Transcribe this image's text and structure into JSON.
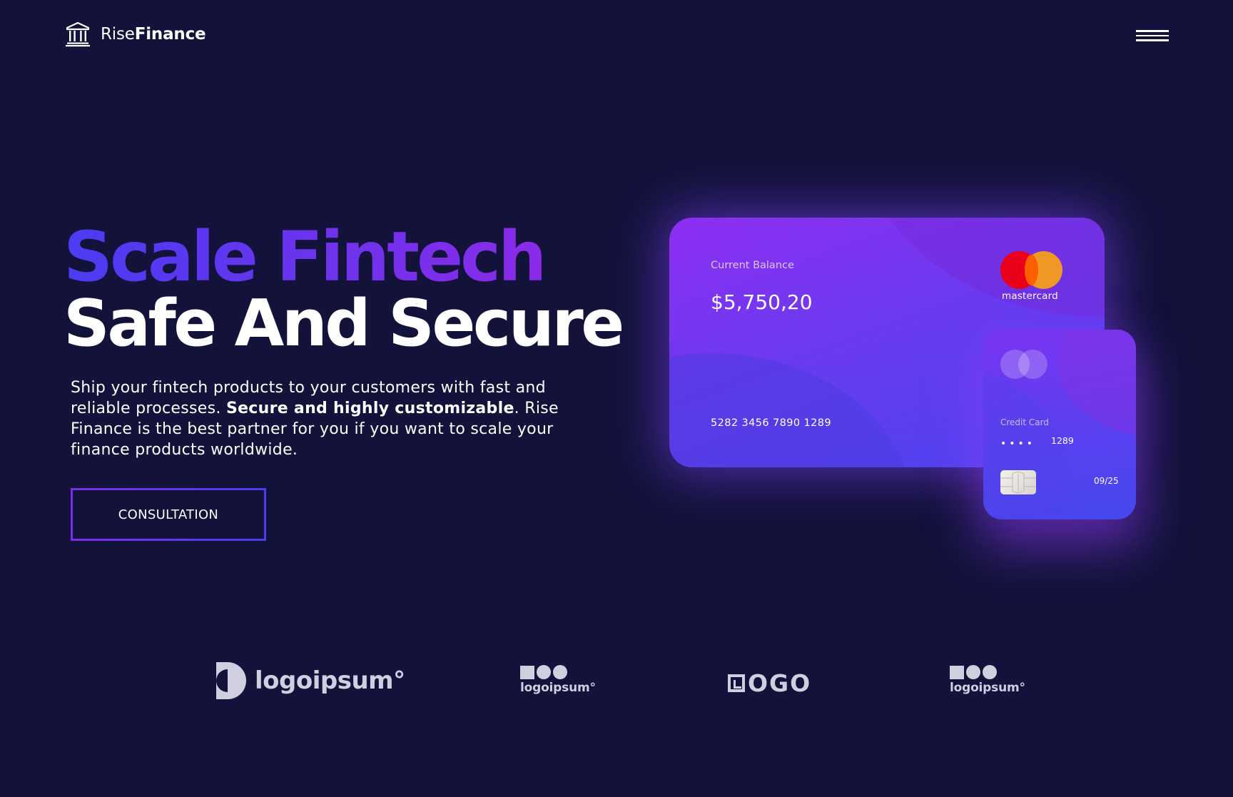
{
  "header": {
    "brand_light": "Rise",
    "brand_bold": "Finance",
    "brand_icon": "bank-icon",
    "menu_icon": "hamburger-menu-icon"
  },
  "hero": {
    "headline_line1": "Scale Fintech",
    "headline_line2": "Safe And Secure",
    "lede_part1": "Ship your fintech products to your customers with fast and reliable processes. ",
    "lede_bold": "Secure and highly customizable",
    "lede_part2": ". Rise Finance is the best partner for you if you want to scale your finance products worldwide.",
    "cta_label": "CONSULTATION"
  },
  "cards": {
    "balance_card": {
      "label": "Current Balance",
      "balance": "$5,750,20",
      "number": "5282 3456 7890 1289",
      "network": "mastercard"
    },
    "credit_card": {
      "label": "Credit Card",
      "masked": "••••",
      "last4": "1289",
      "expiry": "09/25"
    }
  },
  "partners": [
    {
      "text": "logoipsum°"
    },
    {
      "text": "logoipsum°"
    },
    {
      "text": "OGO"
    },
    {
      "text": "logoipsum°"
    }
  ],
  "colors": {
    "background": "#12123a",
    "accent_blue": "#4a3cf2",
    "accent_purple": "#8a2be8",
    "mastercard_red": "#eb001b",
    "mastercard_orange": "#f79e1b"
  }
}
